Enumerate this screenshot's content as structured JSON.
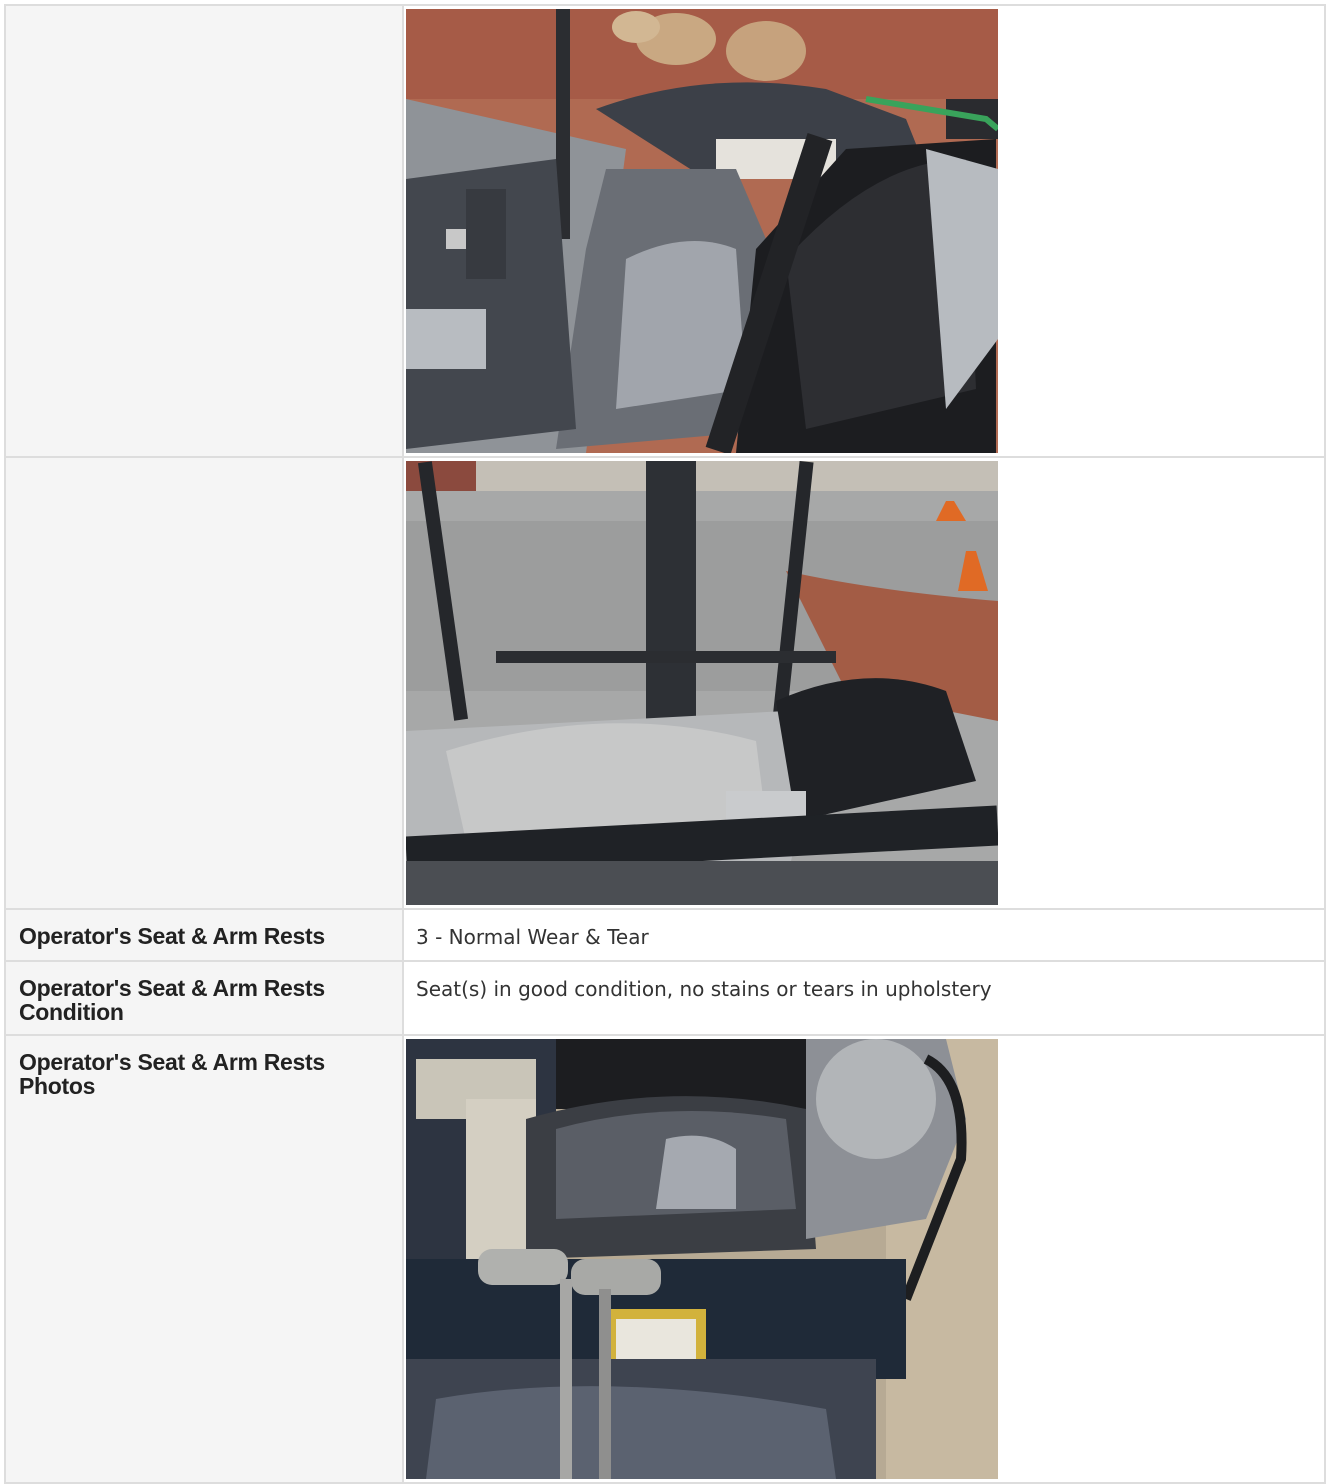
{
  "rows": [
    {
      "label": "",
      "type": "photo",
      "photo": "excavator-cab-seat-side-photo"
    },
    {
      "label": "",
      "type": "photo",
      "photo": "excavator-cab-front-view-photo"
    },
    {
      "label": "Operator's Seat & Arm Rests",
      "type": "text",
      "value": "3 - Normal Wear & Tear"
    },
    {
      "label": "Operator's Seat & Arm Rests Condition",
      "type": "text",
      "value": "Seat(s) in good condition, no stains or tears in upholstery"
    },
    {
      "label": "Operator's Seat & Arm Rests Photos",
      "type": "photo",
      "photo": "operator-seat-controls-photo"
    }
  ]
}
